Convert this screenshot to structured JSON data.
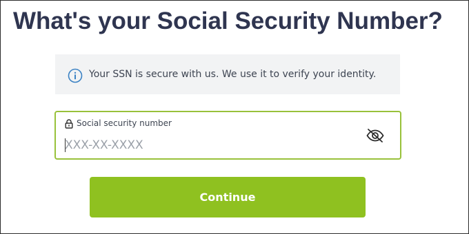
{
  "page": {
    "title": "What's your Social Security Number?"
  },
  "info_banner": {
    "icon": "info-icon",
    "text": "Your SSN is secure with us. We use it to verify your identity."
  },
  "ssn_field": {
    "lock_icon": "lock-icon",
    "label": "Social security number",
    "placeholder": "XXX-XX-XXXX",
    "value": "",
    "toggle_icon": "eye-slash-icon"
  },
  "continue_button": {
    "label": "Continue"
  },
  "colors": {
    "title": "#2f3550",
    "accent_green": "#8fc120",
    "field_border": "#98c13a",
    "banner_bg": "#f2f3f4",
    "info_icon": "#3b82c4"
  }
}
